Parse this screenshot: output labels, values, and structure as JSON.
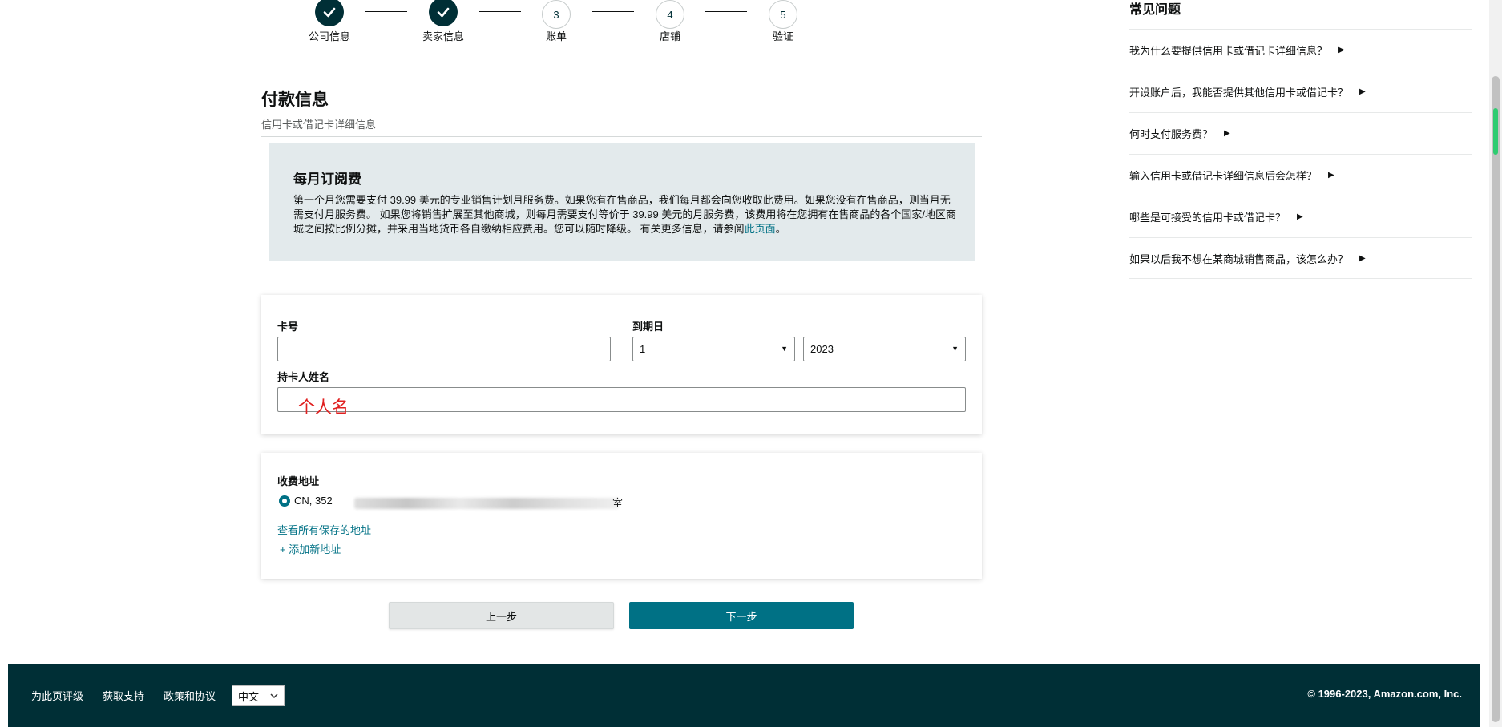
{
  "stepper": [
    {
      "label": "公司信息",
      "number": "1",
      "done": true
    },
    {
      "label": "卖家信息",
      "number": "2",
      "done": true
    },
    {
      "label": "账单",
      "number": "3",
      "done": false
    },
    {
      "label": "店铺",
      "number": "4",
      "done": false
    },
    {
      "label": "验证",
      "number": "5",
      "done": false
    }
  ],
  "payment": {
    "title": "付款信息",
    "subtitle": "信用卡或借记卡详细信息"
  },
  "notice": {
    "title": "每月订阅费",
    "body": "第一个月您需要支付 39.99 美元的专业销售计划月服务费。如果您有在售商品，我们每月都会向您收取此费用。如果您没有在售商品，则当月无需支付月服务费。 如果您将销售扩展至其他商城，则每月需要支付等价于 39.99 美元的月服务费，该费用将在您拥有在售商品的各个国家/地区商城之间按比例分摊，并采用当地货币各自缴纳相应费用。您可以随时降级。 有关更多信息，请参阅",
    "link": "此页面",
    "end": "。"
  },
  "card_form": {
    "card_number_label": "卡号",
    "card_number_value": "",
    "expiry_label": "到期日",
    "expiry_month": "1",
    "expiry_year": "2023",
    "holder_label": "持卡人姓名",
    "holder_value": "",
    "annotation": "个人名"
  },
  "billing": {
    "title": "收费地址",
    "address_prefix": "CN, 352",
    "address_suffix": "室",
    "view_all": "查看所有保存的地址",
    "add_new": "+ 添加新地址"
  },
  "buttons": {
    "prev": "上一步",
    "next": "下一步"
  },
  "faq": {
    "title": "常见问题",
    "items": [
      "我为什么要提供信用卡或借记卡详细信息？",
      "开设账户后，我能否提供其他信用卡或借记卡？",
      "何时支付服务费？",
      "输入信用卡或借记卡详细信息后会怎样？",
      "哪些是可接受的信用卡或借记卡？",
      "如果以后我不想在某商城销售商品，该怎么办？"
    ]
  },
  "footer": {
    "rate": "为此页评级",
    "support": "获取支持",
    "policy": "政策和协议",
    "language": "中文",
    "copyright": "© 1996-2023, Amazon.com, Inc."
  },
  "colors": {
    "teal": "#007185",
    "dark": "#002f36",
    "notice_bg": "#e3eaec",
    "annotation": "#e02020"
  }
}
